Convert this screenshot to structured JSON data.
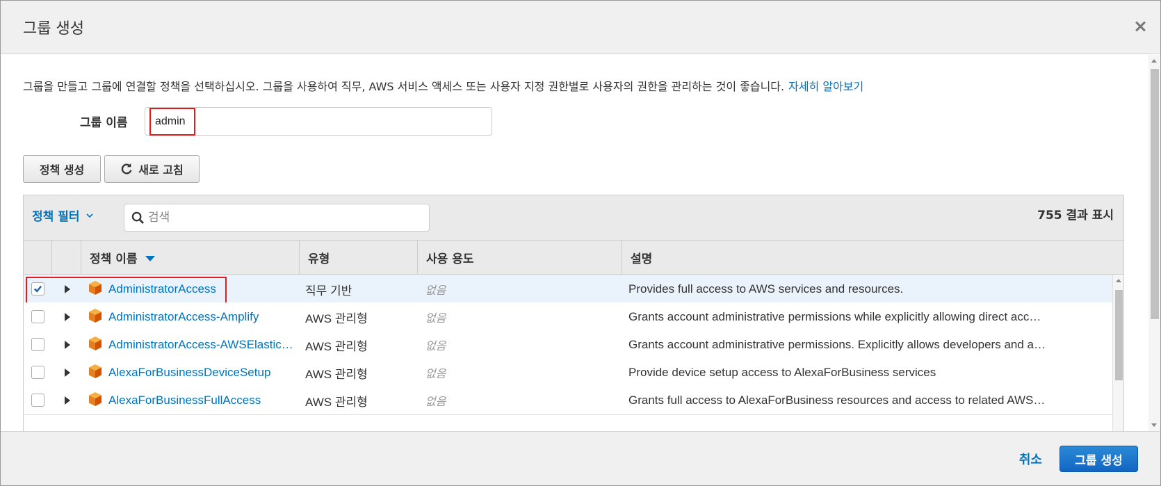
{
  "dialog": {
    "title": "그룹 생성",
    "close_icon": "close-icon"
  },
  "intro": {
    "text": "그룹을 만들고 그룹에 연결할 정책을 선택하십시오. 그룹을 사용하여 직무, AWS 서비스 액세스 또는 사용자 지정 권한별로 사용자의 권한을 관리하는 것이 좋습니다.",
    "link": "자세히 알아보기"
  },
  "group_name": {
    "label": "그룹 이름",
    "value": "admin"
  },
  "buttons": {
    "create_policy": "정책 생성",
    "refresh": "새로 고침"
  },
  "table": {
    "filter_label": "정책 필터",
    "search_placeholder": "검색",
    "result_count": "755 결과 표시",
    "columns": {
      "name": "정책 이름",
      "type": "유형",
      "usage": "사용 용도",
      "description": "설명"
    },
    "rows": [
      {
        "checked": true,
        "name": "AdministratorAccess",
        "type": "직무 기반",
        "usage": "없음",
        "description": "Provides full access to AWS services and resources."
      },
      {
        "checked": false,
        "name": "AdministratorAccess-Amplify",
        "type": "AWS 관리형",
        "usage": "없음",
        "description": "Grants account administrative permissions while explicitly allowing direct acc…"
      },
      {
        "checked": false,
        "name": "AdministratorAccess-AWSElastic…",
        "type": "AWS 관리형",
        "usage": "없음",
        "description": "Grants account administrative permissions. Explicitly allows developers and a…"
      },
      {
        "checked": false,
        "name": "AlexaForBusinessDeviceSetup",
        "type": "AWS 관리형",
        "usage": "없음",
        "description": "Provide device setup access to AlexaForBusiness services"
      },
      {
        "checked": false,
        "name": "AlexaForBusinessFullAccess",
        "type": "AWS 관리형",
        "usage": "없음",
        "description": "Grants full access to AlexaForBusiness resources and access to related AWS…"
      }
    ]
  },
  "footer": {
    "cancel": "취소",
    "create_group": "그룹 생성"
  },
  "colors": {
    "link": "#0073bb",
    "primary": "#1266c3",
    "highlight": "#e01b1b",
    "policy_icon": "#f39c12"
  }
}
